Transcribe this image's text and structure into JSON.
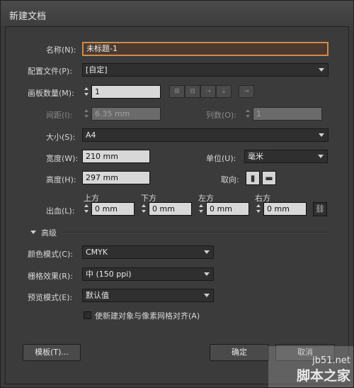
{
  "window": {
    "title": "新建文档"
  },
  "name": {
    "label": "名称(N):",
    "value": "未标题-1"
  },
  "profile": {
    "label": "配置文件(P):",
    "value": "[自定]"
  },
  "artboards": {
    "label": "画板数量(M):",
    "value": "1"
  },
  "spacing": {
    "label": "间距(I):",
    "value": "6.35 mm"
  },
  "columns": {
    "label": "列数(O):",
    "value": "1"
  },
  "size": {
    "label": "大小(S):",
    "value": "A4"
  },
  "width": {
    "label": "宽度(W):",
    "value": "210 mm"
  },
  "units": {
    "label": "单位(U):",
    "value": "毫米"
  },
  "height": {
    "label": "高度(H):",
    "value": "297 mm"
  },
  "orientation": {
    "label": "取向:"
  },
  "bleed": {
    "label": "出血(L):",
    "top_label": "上方",
    "bottom_label": "下方",
    "left_label": "左方",
    "right_label": "右方",
    "top": "0 mm",
    "bottom": "0 mm",
    "left": "0 mm",
    "right": "0 mm"
  },
  "advanced": {
    "label": "高级"
  },
  "color_mode": {
    "label": "颜色模式(C):",
    "value": "CMYK"
  },
  "raster": {
    "label": "栅格效果(R):",
    "value": "中 (150 ppi)"
  },
  "preview": {
    "label": "预览模式(E):",
    "value": "默认值"
  },
  "align_pixel": {
    "label": "使新建对象与像素网格对齐(A)"
  },
  "buttons": {
    "templates": "模板(T)...",
    "ok": "确定",
    "cancel": "取消"
  },
  "watermark": {
    "site": "jb51.net",
    "brand": "脚本之家"
  }
}
